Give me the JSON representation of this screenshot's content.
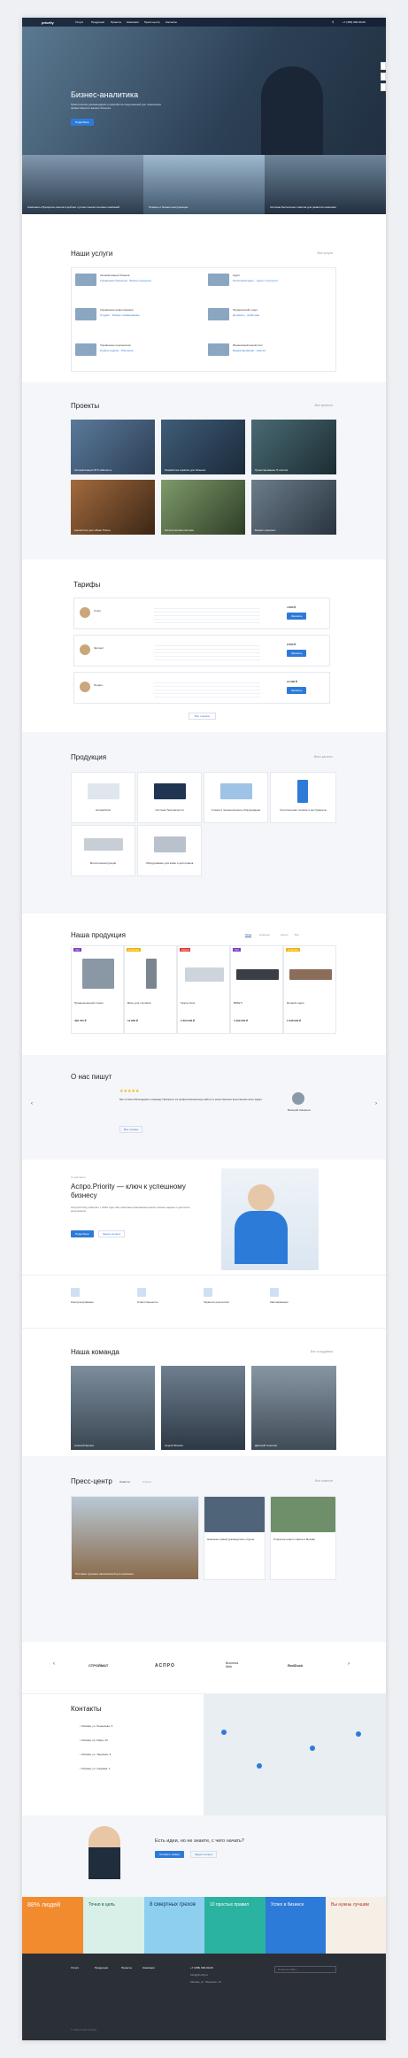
{
  "header": {
    "logo": "priority",
    "menu": [
      "Услуги",
      "Продукция",
      "Проекты",
      "Компания",
      "Пресс-центр",
      "Контакты"
    ],
    "phone": "+7 (495) 000-00-00"
  },
  "hero": {
    "title": "Бизнес-аналитика",
    "text": "Практические рекомендации и разработка предложений для повышения эффективности вашего бизнеса",
    "button": "Подробнее",
    "cards": [
      "Компания «Приорити» вошла в рейтинг лучших консалтинговых компаний",
      "Помощь и бизнес-консультации",
      "Система бесплатных советов для развития компании"
    ]
  },
  "services": {
    "title": "Наши услуги",
    "link": "Все услуги",
    "items": [
      {
        "name": "Автоматизация бизнеса",
        "subs": "Управление бизнесом · Бизнес-процессы"
      },
      {
        "name": "Аудит",
        "subs": "Налоговый аудит · Аудит отчетности"
      },
      {
        "name": "Управление инвестициями",
        "subs": "IT-аудит · Бизнес-планирование"
      },
      {
        "name": "Юридический отдел",
        "subs": "Договоры · Арбитраж"
      },
      {
        "name": "Управление персоналом",
        "subs": "Подбор кадров · Обучение"
      },
      {
        "name": "Финансовый консалтинг",
        "subs": "Бюджетирование · Анализ"
      }
    ]
  },
  "projects": {
    "title": "Проекты",
    "link": "Все проекты",
    "items": [
      "Автоматизация ЗТЛ «Металл»",
      "Разработка сервиса для бизнеса",
      "Проектирование IT-систем",
      "Консалтинг для «Банк Плюс»",
      "Логистическая система",
      "Бизнес-тренинги"
    ]
  },
  "tariffs": {
    "title": "Тарифы",
    "link": "Все тарифы",
    "items": [
      {
        "name": "Старт",
        "price": "4 990 ₽",
        "button": "Заказать"
      },
      {
        "name": "Эксперт",
        "price": "9 990 ₽",
        "button": "Заказать"
      },
      {
        "name": "Профи",
        "price": "14 990 ₽",
        "button": "Заказать"
      }
    ]
  },
  "products": {
    "title": "Продукция",
    "link": "Весь каталог",
    "items": [
      "Автомобили",
      "Системы безопасности",
      "Станки и промышленное оборудование",
      "Строительная техника и инструменты",
      "Металлоконструкции",
      "Оборудование для кафе и ресторанов"
    ]
  },
  "shop": {
    "title": "Наша продукция",
    "tabs": [
      "Хиты",
      "Новинки",
      "Акции",
      "Все"
    ],
    "items": [
      {
        "badge": "Хит",
        "name": "Промышленный станок",
        "price": "436 700 ₽"
      },
      {
        "badge": "Новинка",
        "name": "Весы для торговли",
        "price": "12 850 ₽"
      },
      {
        "badge": "Акция",
        "name": "Газель Next",
        "price": "2 300 000 ₽"
      },
      {
        "badge": "Хит",
        "name": "BMW 5",
        "price": "4 499 000 ₽"
      },
      {
        "badge": "Новинка",
        "name": "Renault Logan",
        "price": "1 038 000 ₽"
      }
    ]
  },
  "reviews": {
    "title": "О нас пишут",
    "text": "Мы хотим поблагодарить команду Приорити за профессиональную работу и качественное выполнение всех задач.",
    "author": "Валерий Смирнов",
    "link": "Все отзывы"
  },
  "about": {
    "label": "О компании",
    "title": "Аспро.Priority — ключ к успешному бизнесу",
    "text": "Аспро.Priority работает с 2010 года. Мы помогаем компаниям решать бизнес-задачи и достигать результатов.",
    "button": "Подробнее",
    "link": "Задать вопрос"
  },
  "features": [
    "Консультирование",
    "Ответственность",
    "Гарантия результата",
    "Квалификация"
  ],
  "team": {
    "title": "Наша команда",
    "link": "Все сотрудники",
    "members": [
      "Алексей Ершов",
      "Сергей Волков",
      "Дмитрий Соколов"
    ]
  },
  "press": {
    "title": "Пресс-центр",
    "tabs": [
      "Новости",
      "Статьи"
    ],
    "link": "Все новости",
    "items": [
      "Поставка грузовых автомобилей для компании",
      "Назначен новый руководитель отдела",
      "Открытие нового офиса в Москве"
    ]
  },
  "partners": [
    "СТРОЙМАТ",
    "АСПРО",
    "Business Web",
    "RedDock"
  ],
  "contacts": {
    "title": "Контакты",
    "items": [
      "г. Москва, ул. Ленинская, 5",
      "г. Москва, пр. Мира, 22",
      "г. Москва, ул. Тверская, 9",
      "г. Москва, ул. Садовая, 1"
    ]
  },
  "cta": {
    "title": "Есть идеи, но не знаете, с чего начать?",
    "button": "Оставить заявку",
    "link": "Задать вопрос"
  },
  "banners": [
    "88% людей",
    "Точно в цель",
    "8 смертных грехов",
    "10 простых правил",
    "Успех в бизнесе",
    "Вы нужны лучшим"
  ],
  "footer": {
    "cols": [
      "Услуги",
      "Продукция",
      "Проекты",
      "Компания"
    ],
    "phone": "+7 (495) 000-00-00",
    "email": "info@priority.ru",
    "address": "Москва, ул. Тверская, 14",
    "search": "Поиск по сайту",
    "copy": "© 2024 Аспро.Priority"
  }
}
